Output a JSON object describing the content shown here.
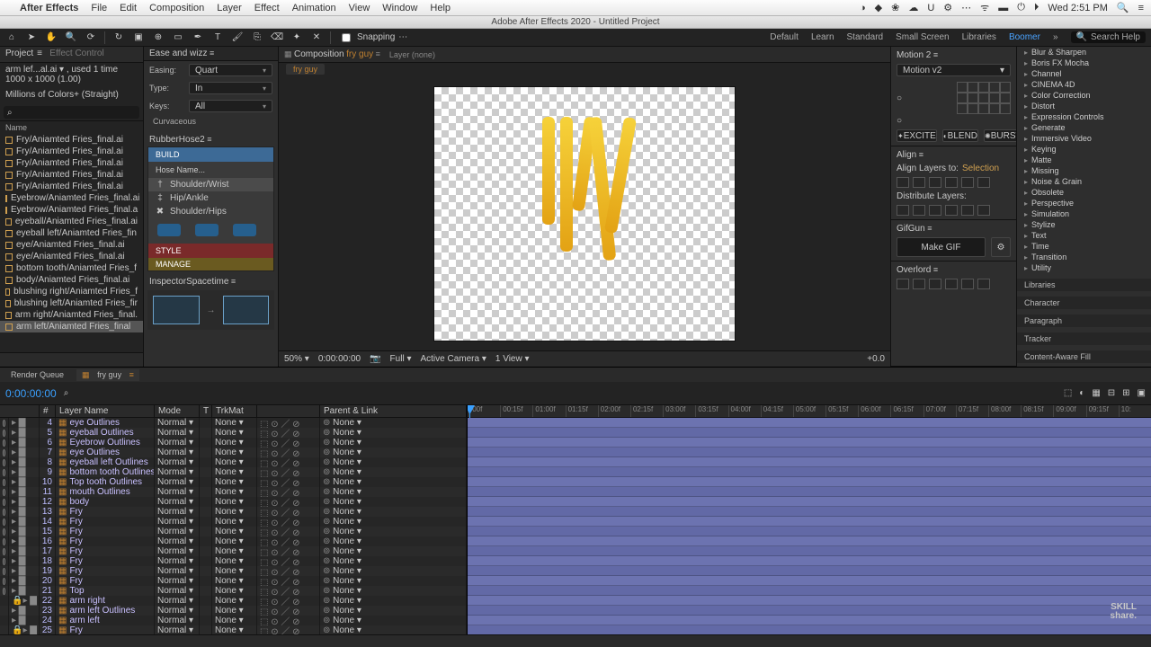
{
  "mac_menu": {
    "apple": "",
    "app": "After Effects",
    "items": [
      "File",
      "Edit",
      "Composition",
      "Layer",
      "Effect",
      "Animation",
      "View",
      "Window",
      "Help"
    ],
    "clock": "Wed 2:51 PM"
  },
  "window_title": "Adobe After Effects 2020 - Untitled Project",
  "toolbar": {
    "snapping": "Snapping",
    "workspaces": [
      "Default",
      "Learn",
      "Standard",
      "Small Screen",
      "Libraries",
      "Boomer"
    ],
    "active_ws": "Boomer",
    "search_placeholder": "Search Help"
  },
  "project": {
    "tab": "Project",
    "effect_tab": "Effect Control",
    "info_line1": "arm lef...al.ai ▾ , used 1 time",
    "info_line2": "1000 x 1000 (1.00)",
    "info_line3": "Millions of Colors+ (Straight)",
    "name_col": "Name",
    "assets": [
      "Fry/Aniamted Fries_final.ai",
      "Fry/Aniamted Fries_final.ai",
      "Fry/Aniamted Fries_final.ai",
      "Fry/Aniamted Fries_final.ai",
      "Fry/Aniamted Fries_final.ai",
      "Eyebrow/Aniamted Fries_final.ai",
      "Eyebrow/Aniamted Fries_final.a",
      "eyeball/Aniamted Fries_final.ai",
      "eyeball left/Aniamted Fries_fin",
      "eye/Aniamted Fries_final.ai",
      "eye/Aniamted Fries_final.ai",
      "bottom tooth/Aniamted Fries_f",
      "body/Aniamted Fries_final.ai",
      "blushing right/Aniamted Fries_f",
      "blushing left/Aniamted Fries_fir",
      "arm right/Aniamted Fries_final.",
      "arm left/Aniamted Fries_final"
    ],
    "selected_index": 16
  },
  "ease": {
    "tab": "Ease and wizz",
    "rows": {
      "Easing": "Quart",
      "Type": "In",
      "Keys": "All"
    },
    "curv": "Curvaceous"
  },
  "rubberhose": {
    "tab": "RubberHose2",
    "build": "BUILD",
    "hose_name": "Hose Name...",
    "items": [
      {
        "icon": "†",
        "label": "Shoulder/Wrist",
        "sel": true
      },
      {
        "icon": "‡",
        "label": "Hip/Ankle",
        "sel": false
      },
      {
        "icon": "✖",
        "label": "Shoulder/Hips",
        "sel": false
      }
    ],
    "style": "STYLE",
    "manage": "MANAGE"
  },
  "inspector": {
    "tab": "InspectorSpacetime"
  },
  "comp": {
    "crumb_prefix": "Composition",
    "name": "fry guy",
    "layer_crumb": "Layer (none)",
    "subtab": "fry guy",
    "footer": {
      "zoom": "50%",
      "time": "0:00:00:00",
      "res": "Full",
      "camera": "Active Camera",
      "views": "1 View",
      "exposure": "+0.0"
    }
  },
  "motion": {
    "tab": "Motion 2",
    "dropdown": "Motion v2",
    "btns": [
      "EXCITE",
      "BLEND",
      "BURST"
    ]
  },
  "align": {
    "tab": "Align",
    "layers_to": "Align Layers to:",
    "sel": "Selection",
    "dist": "Distribute Layers:"
  },
  "gifgun": {
    "tab": "GifGun",
    "make": "Make GIF"
  },
  "overlord": {
    "tab": "Overlord"
  },
  "effects": {
    "items": [
      "Blur & Sharpen",
      "Boris FX Mocha",
      "Channel",
      "CINEMA 4D",
      "Color Correction",
      "Distort",
      "Expression Controls",
      "Generate",
      "Immersive Video",
      "Keying",
      "Matte",
      "Missing",
      "Noise & Grain",
      "Obsolete",
      "Perspective",
      "Simulation",
      "Stylize",
      "Text",
      "Time",
      "Transition",
      "Utility"
    ],
    "subs": [
      "Libraries",
      "Character",
      "Paragraph",
      "Tracker",
      "Content-Aware Fill"
    ]
  },
  "timeline": {
    "render_tab": "Render Queue",
    "comp_tab": "fry guy",
    "timecode": "0:00:00:00",
    "cols": [
      "",
      "#",
      "Layer Name",
      "Mode",
      "T",
      "TrkMat",
      "⚙☀✦⚑fx",
      "Parent & Link"
    ],
    "ruler": [
      ":00f",
      "00:15f",
      "01:00f",
      "01:15f",
      "02:00f",
      "02:15f",
      "03:00f",
      "03:15f",
      "04:00f",
      "04:15f",
      "05:00f",
      "05:15f",
      "06:00f",
      "06:15f",
      "07:00f",
      "07:15f",
      "08:00f",
      "08:15f",
      "09:00f",
      "09:15f",
      "10:"
    ],
    "layers": [
      {
        "n": 4,
        "name": "eye Outlines",
        "mode": "Normal",
        "trk": "None",
        "parent": "None",
        "vis": true,
        "lock": false
      },
      {
        "n": 5,
        "name": "eyeball Outlines",
        "mode": "Normal",
        "trk": "None",
        "parent": "None",
        "vis": true,
        "lock": false
      },
      {
        "n": 6,
        "name": "Eyebrow Outlines",
        "mode": "Normal",
        "trk": "None",
        "parent": "None",
        "vis": true,
        "lock": false
      },
      {
        "n": 7,
        "name": "eye Outlines",
        "mode": "Normal",
        "trk": "None",
        "parent": "None",
        "vis": true,
        "lock": false
      },
      {
        "n": 8,
        "name": "eyeball left Outlines",
        "mode": "Normal",
        "trk": "None",
        "parent": "None",
        "vis": true,
        "lock": false
      },
      {
        "n": 9,
        "name": "bottom tooth Outlines",
        "mode": "Normal",
        "trk": "None",
        "parent": "None",
        "vis": true,
        "lock": false
      },
      {
        "n": 10,
        "name": "Top tooth Outlines",
        "mode": "Normal",
        "trk": "None",
        "parent": "None",
        "vis": true,
        "lock": false
      },
      {
        "n": 11,
        "name": "mouth Outlines",
        "mode": "Normal",
        "trk": "None",
        "parent": "None",
        "vis": true,
        "lock": false
      },
      {
        "n": 12,
        "name": "body",
        "mode": "Normal",
        "trk": "None",
        "parent": "None",
        "vis": true,
        "lock": false
      },
      {
        "n": 13,
        "name": "Fry",
        "mode": "Normal",
        "trk": "None",
        "parent": "None",
        "vis": true,
        "lock": false
      },
      {
        "n": 14,
        "name": "Fry",
        "mode": "Normal",
        "trk": "None",
        "parent": "None",
        "vis": true,
        "lock": false
      },
      {
        "n": 15,
        "name": "Fry",
        "mode": "Normal",
        "trk": "None",
        "parent": "None",
        "vis": true,
        "lock": false
      },
      {
        "n": 16,
        "name": "Fry",
        "mode": "Normal",
        "trk": "None",
        "parent": "None",
        "vis": true,
        "lock": false
      },
      {
        "n": 17,
        "name": "Fry",
        "mode": "Normal",
        "trk": "None",
        "parent": "None",
        "vis": true,
        "lock": false
      },
      {
        "n": 18,
        "name": "Fry",
        "mode": "Normal",
        "trk": "None",
        "parent": "None",
        "vis": true,
        "lock": false
      },
      {
        "n": 19,
        "name": "Fry",
        "mode": "Normal",
        "trk": "None",
        "parent": "None",
        "vis": true,
        "lock": false
      },
      {
        "n": 20,
        "name": "Fry",
        "mode": "Normal",
        "trk": "None",
        "parent": "None",
        "vis": true,
        "lock": false
      },
      {
        "n": 21,
        "name": "Top",
        "mode": "Normal",
        "trk": "None",
        "parent": "None",
        "vis": true,
        "lock": false
      },
      {
        "n": 22,
        "name": "arm right",
        "mode": "Normal",
        "trk": "None",
        "parent": "None",
        "vis": false,
        "lock": true
      },
      {
        "n": 23,
        "name": "arm left Outlines",
        "mode": "Normal",
        "trk": "None",
        "parent": "None",
        "vis": false,
        "lock": false
      },
      {
        "n": 24,
        "name": "arm left",
        "mode": "Normal",
        "trk": "None",
        "parent": "None",
        "vis": false,
        "lock": false
      },
      {
        "n": 25,
        "name": "Fry",
        "mode": "Normal",
        "trk": "None",
        "parent": "None",
        "vis": false,
        "lock": true
      }
    ]
  },
  "watermark": {
    "l1": "SKILL",
    "l2": "share."
  }
}
